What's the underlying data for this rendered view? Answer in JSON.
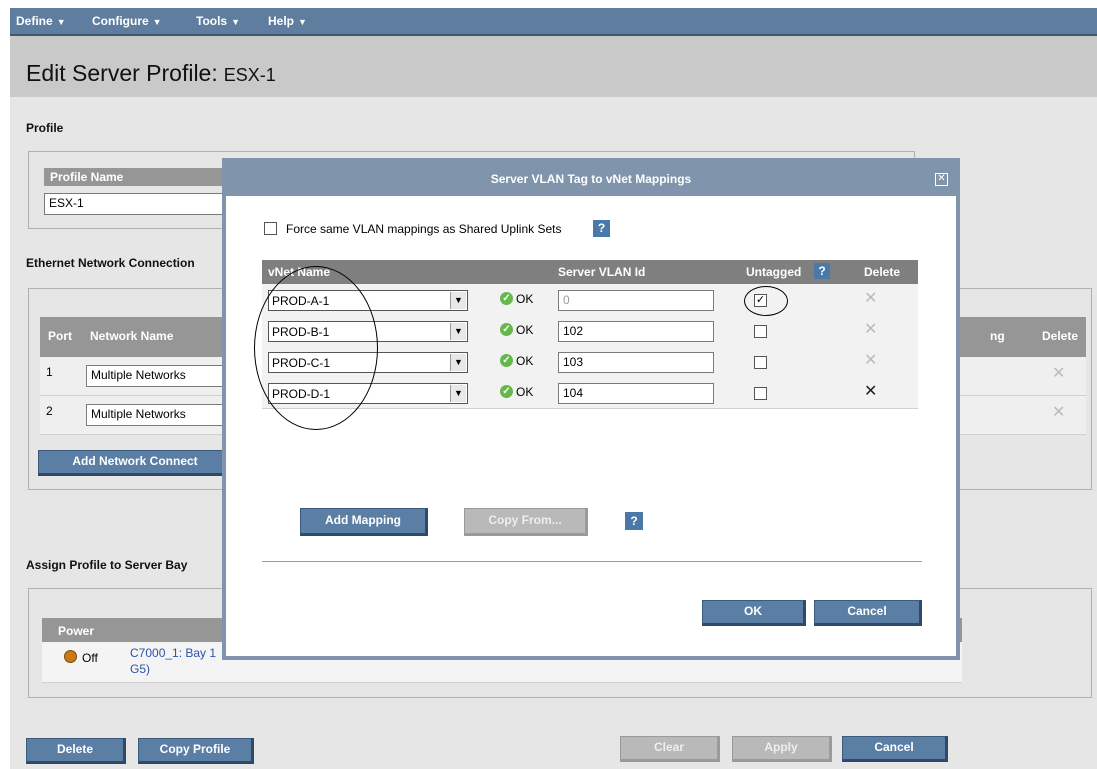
{
  "menu": {
    "items": [
      {
        "label": "Define"
      },
      {
        "label": "Configure"
      },
      {
        "label": "Tools"
      },
      {
        "label": "Help"
      }
    ]
  },
  "page": {
    "title": "Edit Server Profile:",
    "profile_name_display": "ESX-1"
  },
  "profile_section": {
    "heading": "Profile",
    "name_header": "Profile Name",
    "name_value": "ESX-1"
  },
  "ethernet_section": {
    "heading": "Ethernet Network Connection",
    "headers": {
      "port": "Port",
      "network_name": "Network Name",
      "right_partial": "ng",
      "delete": "Delete"
    },
    "rows": [
      {
        "port": "1",
        "network": "Multiple Networks"
      },
      {
        "port": "2",
        "network": "Multiple Networks"
      }
    ],
    "add_button": "Add Network Connect"
  },
  "assign_section": {
    "heading": "Assign Profile to Server Bay",
    "power_header": "Power",
    "power_state": "Off",
    "bay_line1": "C7000_1: Bay 1",
    "bay_line2": "G5)"
  },
  "footer_buttons": {
    "delete": "Delete",
    "copy_profile": "Copy Profile",
    "clear": "Clear",
    "apply": "Apply",
    "cancel": "Cancel"
  },
  "modal": {
    "title": "Server VLAN Tag to vNet Mappings",
    "force_label": "Force same VLAN mappings as Shared Uplink Sets",
    "help_glyph": "?",
    "columns": {
      "vnet_name": "vNet Name",
      "vlan_id": "Server VLAN Id",
      "untagged": "Untagged",
      "delete": "Delete"
    },
    "rows": [
      {
        "vnet": "PROD-A-1",
        "status": "OK",
        "vlan": "0",
        "untagged": true
      },
      {
        "vnet": "PROD-B-1",
        "status": "OK",
        "vlan": "102",
        "untagged": false
      },
      {
        "vnet": "PROD-C-1",
        "status": "OK",
        "vlan": "103",
        "untagged": false
      },
      {
        "vnet": "PROD-D-1",
        "status": "OK",
        "vlan": "104",
        "untagged": false
      }
    ],
    "add_mapping": "Add Mapping",
    "copy_from": "Copy From...",
    "ok": "OK",
    "cancel": "Cancel"
  }
}
